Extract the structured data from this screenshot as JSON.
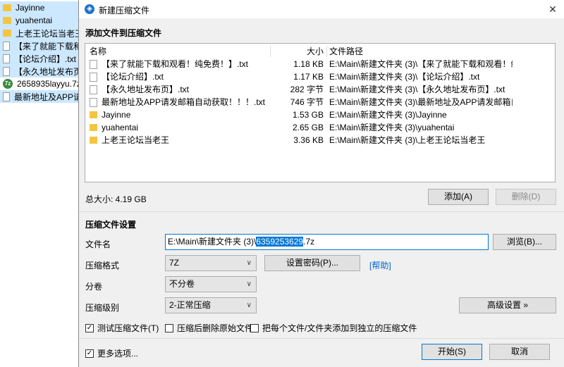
{
  "explorer": {
    "items": [
      {
        "name": "Jayinne",
        "type": "folder",
        "selected": true
      },
      {
        "name": "yuahentai",
        "type": "folder",
        "selected": true
      },
      {
        "name": "上老王论坛当老王",
        "type": "folder",
        "selected": true
      },
      {
        "name": "【来了就能下载和观",
        "type": "file",
        "selected": true
      },
      {
        "name": "【论坛介绍】.txt",
        "type": "file",
        "selected": true
      },
      {
        "name": "【永久地址发布页】",
        "type": "file",
        "selected": true
      },
      {
        "name": "2658935layyu.7z",
        "type": "7z",
        "selected": false
      },
      {
        "name": "最新地址及APP请发",
        "type": "file",
        "selected": true
      }
    ]
  },
  "dialog": {
    "title": "新建压缩文件",
    "close_symbol": "✕",
    "add_section_title": "添加文件到压缩文件",
    "columns": {
      "name": "名称",
      "size": "大小",
      "path": "文件路径"
    },
    "files": [
      {
        "name": "【来了就能下载和观看！纯免费！】.txt",
        "size": "1.18 KB",
        "path": "E:\\Main\\新建文件夹 (3)\\【来了就能下载和观看！纯...",
        "type": "file"
      },
      {
        "name": "【论坛介绍】.txt",
        "size": "1.17 KB",
        "path": "E:\\Main\\新建文件夹 (3)\\【论坛介绍】.txt",
        "type": "file"
      },
      {
        "name": "【永久地址发布页】.txt",
        "size": "282 字节",
        "path": "E:\\Main\\新建文件夹 (3)\\【永久地址发布页】.txt",
        "type": "file"
      },
      {
        "name": "最新地址及APP请发邮箱自动获取！！！.txt",
        "size": "746 字节",
        "path": "E:\\Main\\新建文件夹 (3)\\最新地址及APP请发邮箱自...",
        "type": "file"
      },
      {
        "name": "Jayinne",
        "size": "1.53 GB",
        "path": "E:\\Main\\新建文件夹 (3)\\Jayinne",
        "type": "folder"
      },
      {
        "name": "yuahentai",
        "size": "2.65 GB",
        "path": "E:\\Main\\新建文件夹 (3)\\yuahentai",
        "type": "folder"
      },
      {
        "name": "上老王论坛当老王",
        "size": "3.36 KB",
        "path": "E:\\Main\\新建文件夹 (3)\\上老王论坛当老王",
        "type": "folder"
      }
    ],
    "total_size": "总大小: 4.19 GB",
    "add_button": "添加(A)",
    "delete_button": "删除(D)",
    "settings_title": "压缩文件设置",
    "filename_label": "文件名",
    "filename_prefix": "E:\\Main\\新建文件夹 (3)\\",
    "filename_selected": "6359253629",
    "filename_suffix": ".7z",
    "browse_button": "浏览(B)...",
    "format_label": "压缩格式",
    "format_value": "7Z",
    "set_password_button": "设置密码(P)...",
    "help_link": "[帮助]",
    "split_label": "分卷",
    "split_value": "不分卷",
    "level_label": "压缩级别",
    "level_value": "2-正常压缩",
    "advanced_button": "高级设置 »",
    "options": [
      {
        "label": "测试压缩文件(T)",
        "checked": true
      },
      {
        "label": "压缩后删除原始文件",
        "checked": false
      },
      {
        "label": "把每个文件/文件夹添加到独立的压缩文件",
        "checked": false
      }
    ],
    "more_options": {
      "label": "更多选项...",
      "checked": true
    },
    "start_button": "开始(S)",
    "cancel_button": "取消"
  }
}
